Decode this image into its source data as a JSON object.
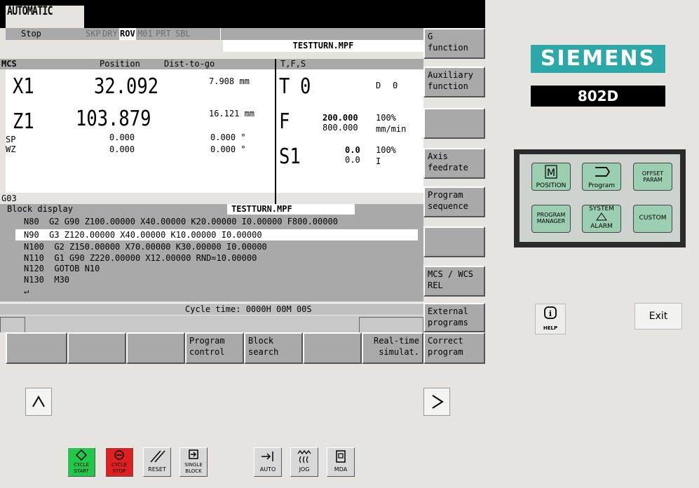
{
  "mode": "AUTOMATIC",
  "status": {
    "state": "Stop",
    "skp": "SKP",
    "dry": "DRY",
    "rov": "ROV",
    "m01": "M01",
    "prt": "PRT",
    "sbl": "SBL"
  },
  "program_name": "TESTTURN.MPF",
  "headers": {
    "mcs": "MCS",
    "position": "Position",
    "dist": "Dist-to-go",
    "tfs": "T,F,S"
  },
  "axes": [
    {
      "name": "X1",
      "pos": "32.092",
      "dist": "7.908 mm"
    },
    {
      "name": "Z1",
      "pos": "103.879",
      "dist": "16.121 mm"
    }
  ],
  "spindles": [
    {
      "name": "SP",
      "pos": "0.000",
      "dist": "0.000 °"
    },
    {
      "name": "WZ",
      "pos": "0.000",
      "dist": "0.000 °"
    }
  ],
  "tool": {
    "label": "T",
    "value": "0",
    "d_label": "D",
    "d_value": "0"
  },
  "feed": {
    "label": "F",
    "actual": "200.000",
    "set": "800.000",
    "pct": "100%",
    "unit": "mm/min"
  },
  "spindle": {
    "label": "S1",
    "actual": "0.0",
    "set": "0.0",
    "pct": "100%",
    "dir": "I"
  },
  "gcode": "G03",
  "block_display": {
    "title": "Block display",
    "file": "TESTTURN.MPF",
    "lines": [
      "N80  G2 G90 Z100.00000 X40.00000 K20.00000 I0.00000 F800.00000",
      "N90  G3 Z120.00000 X40.00000 K10.00000 I0.00000",
      "N100  G2 Z150.00000 X70.00000 K30.00000 I0.00000",
      "N110  G1 G90 Z220.00000 X12.00000 RND=10.00000",
      "N120  GOTOB N10",
      "N130  M30",
      "↵"
    ]
  },
  "cycle_time": "Cycle time: 0000H 00M 00S",
  "vertical_softkeys": [
    [
      "G",
      "function"
    ],
    [
      "Auxiliary",
      "function"
    ],
    [
      "",
      ""
    ],
    [
      "Axis",
      "feedrate"
    ],
    [
      "Program",
      "sequence"
    ],
    [
      "",
      ""
    ],
    [
      "MCS / WCS",
      "REL"
    ],
    [
      "External",
      "programs"
    ]
  ],
  "horizontal_softkeys": [
    [
      "",
      ""
    ],
    [
      "",
      ""
    ],
    [
      "",
      ""
    ],
    [
      "Program",
      "control"
    ],
    [
      "Block",
      "search"
    ],
    [
      "",
      ""
    ],
    [
      "Real-time",
      "simulat."
    ],
    [
      "Correct",
      "program"
    ]
  ],
  "brand": "SIEMENS",
  "model": "802D",
  "panel_keys": {
    "position": "POSITION",
    "program": "Program",
    "offset_param": "OFFSET PARAM",
    "program_manager": "PROGRAM MANAGER",
    "system_alarm_top": "SYSTEM",
    "system_alarm_bottom": "ALARM",
    "custom": "CUSTOM"
  },
  "help": "HELP",
  "exit": "Exit",
  "machine_buttons": {
    "cycle_start": "CYCLE START",
    "cycle_stop": "CYCLE STOP",
    "reset": "RESET",
    "single_block": "SINGLE BLOCK",
    "auto": "AUTO",
    "jog": "JOG",
    "mda": "MDA"
  },
  "colors": {
    "brand": "#2da8a8",
    "cycle_start": "#22c84a",
    "cycle_stop": "#e02020",
    "panel_key": "#9ccfb2"
  }
}
